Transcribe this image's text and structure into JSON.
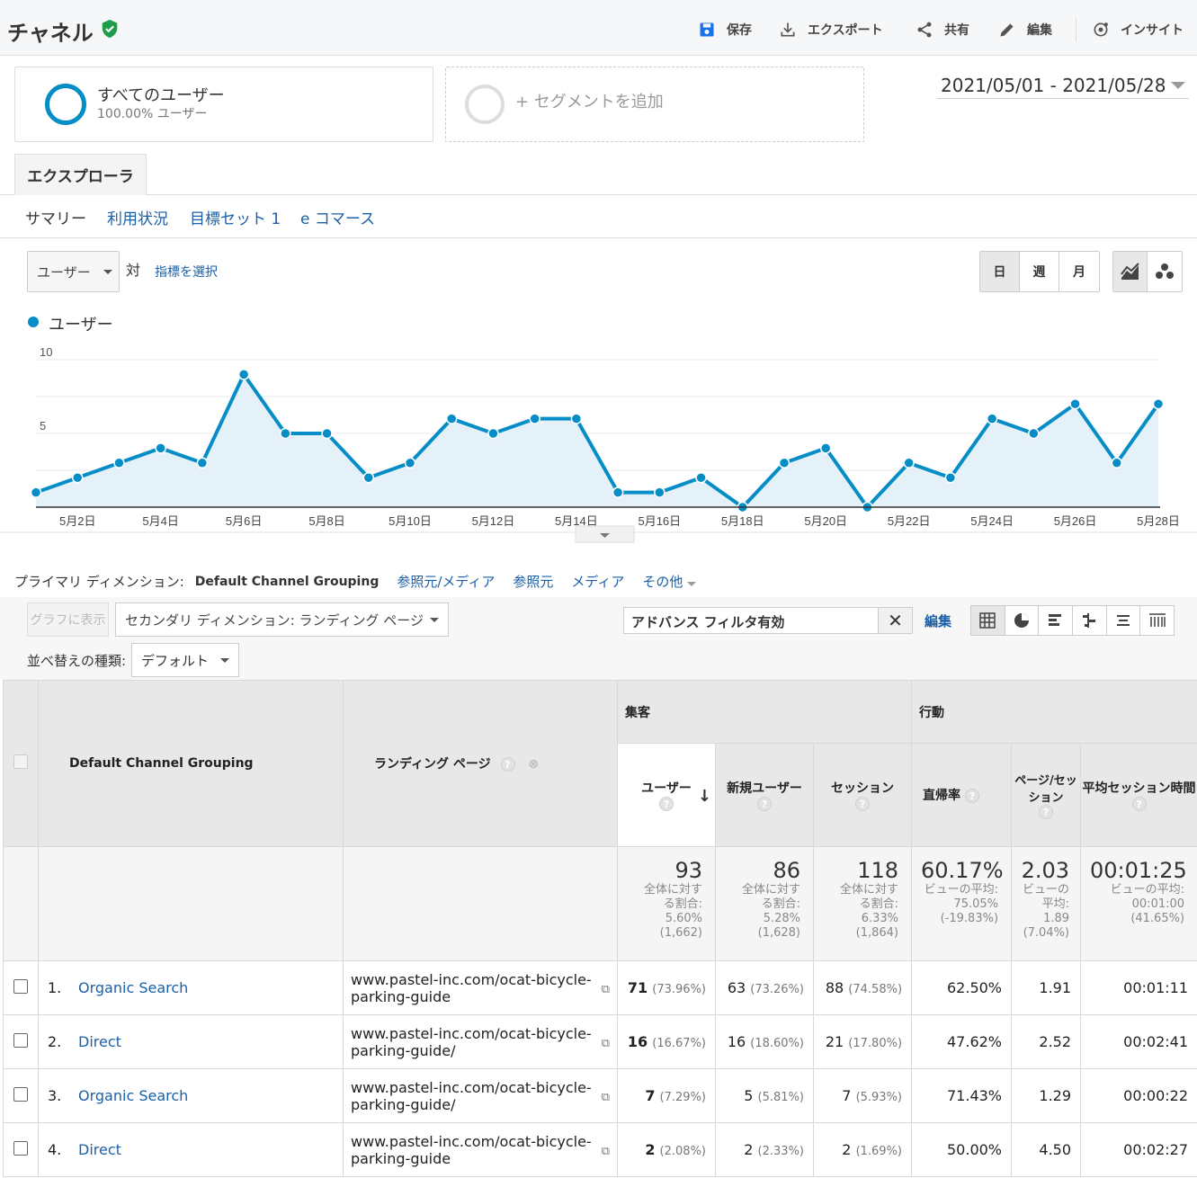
{
  "header": {
    "title": "チャネル",
    "toolbar": [
      {
        "icon": "save-icon",
        "label": "保存"
      },
      {
        "icon": "export-icon",
        "label": "エクスポート"
      },
      {
        "icon": "share-icon",
        "label": "共有"
      },
      {
        "icon": "edit-icon",
        "label": "編集"
      },
      {
        "icon": "insight-icon",
        "label": "インサイト"
      }
    ]
  },
  "segments": {
    "all_users": {
      "title": "すべてのユーザー",
      "sub": "100.00% ユーザー"
    },
    "add_label": "+ セグメントを追加"
  },
  "date_range": "2021/05/01 - 2021/05/28",
  "explorer_tab": "エクスプローラ",
  "subtabs": [
    "サマリー",
    "利用状況",
    "目標セット 1",
    "e コマース"
  ],
  "chart_controls": {
    "metric": "ユーザー",
    "vs": "対",
    "select_metric": "指標を選択",
    "periods": [
      "日",
      "週",
      "月"
    ],
    "active_period": "日"
  },
  "chart_data": {
    "type": "area",
    "series": [
      {
        "name": "ユーザー",
        "color": "#058dc7",
        "values": [
          1,
          2,
          3,
          4,
          3,
          9,
          5,
          5,
          2,
          3,
          6,
          5,
          6,
          6,
          1,
          1,
          2,
          0,
          3,
          4,
          0,
          3,
          2,
          6,
          5,
          7,
          3,
          7
        ]
      }
    ],
    "x": [
      "5月1日",
      "5月2日",
      "5月3日",
      "5月4日",
      "5月5日",
      "5月6日",
      "5月7日",
      "5月8日",
      "5月9日",
      "5月10日",
      "5月11日",
      "5月12日",
      "5月13日",
      "5月14日",
      "5月15日",
      "5月16日",
      "5月17日",
      "5月18日",
      "5月19日",
      "5月20日",
      "5月21日",
      "5月22日",
      "5月23日",
      "5月24日",
      "5月25日",
      "5月26日",
      "5月27日",
      "5月28日"
    ],
    "x_tick_labels": [
      "5月2日",
      "5月4日",
      "5月6日",
      "5月8日",
      "5月10日",
      "5月12日",
      "5月14日",
      "5月16日",
      "5月18日",
      "5月20日",
      "5月22日",
      "5月24日",
      "5月26日",
      "5月28日"
    ],
    "y_ticks": [
      "10",
      "5"
    ],
    "ylim": [
      0,
      10
    ],
    "grid": true,
    "legend": "top-left"
  },
  "primary_dimension": {
    "label": "プライマリ ディメンション:",
    "selected": "Default Channel Grouping",
    "options": [
      "参照元/メディア",
      "参照元",
      "メディア",
      "その他"
    ]
  },
  "table_toolbar": {
    "plot_rows": "グラフに表示",
    "secondary_dimension": "セカンダリ ディメンション: ランディング ページ",
    "filter": "アドバンス フィルタ有効",
    "edit": "編集",
    "sort_label": "並べ替えの種類:",
    "sort_value": "デフォルト"
  },
  "table": {
    "col_channel": "Default Channel Grouping",
    "col_landing": "ランディング ページ",
    "group_acq": "集客",
    "group_beh": "行動",
    "col_users": "ユーザー",
    "col_new_users": "新規ユーザー",
    "col_sessions": "セッション",
    "col_bounce": "直帰率",
    "col_pps": "ページ/セッション",
    "col_avg": "平均セッション時間",
    "totals": {
      "users": "93",
      "users_sub": "全体に対する割合: 5.60% (1,662)",
      "new_users": "86",
      "new_users_sub": "全体に対する割合: 5.28% (1,628)",
      "sessions": "118",
      "sessions_sub": "全体に対する割合: 6.33% (1,864)",
      "bounce": "60.17%",
      "bounce_sub": "ビューの平均: 75.05% (-19.83%)",
      "pps": "2.03",
      "pps_sub": "ビューの平均: 1.89 (7.04%)",
      "avg": "00:01:25",
      "avg_sub": "ビューの平均: 00:01:00 (41.65%)"
    },
    "rows": [
      {
        "idx": "1.",
        "channel": "Organic Search",
        "landing": "www.pastel-inc.com/ocat-bicycle-parking-guide",
        "users": "71",
        "users_pct": "(73.96%)",
        "new_users": "63",
        "new_users_pct": "(73.26%)",
        "sessions": "88",
        "sessions_pct": "(74.58%)",
        "bounce": "62.50%",
        "pps": "1.91",
        "avg": "00:01:11"
      },
      {
        "idx": "2.",
        "channel": "Direct",
        "landing": "www.pastel-inc.com/ocat-bicycle-parking-guide/",
        "users": "16",
        "users_pct": "(16.67%)",
        "new_users": "16",
        "new_users_pct": "(18.60%)",
        "sessions": "21",
        "sessions_pct": "(17.80%)",
        "bounce": "47.62%",
        "pps": "2.52",
        "avg": "00:02:41"
      },
      {
        "idx": "3.",
        "channel": "Organic Search",
        "landing": "www.pastel-inc.com/ocat-bicycle-parking-guide/",
        "users": "7",
        "users_pct": "(7.29%)",
        "new_users": "5",
        "new_users_pct": "(5.81%)",
        "sessions": "7",
        "sessions_pct": "(5.93%)",
        "bounce": "71.43%",
        "pps": "1.29",
        "avg": "00:00:22"
      },
      {
        "idx": "4.",
        "channel": "Direct",
        "landing": "www.pastel-inc.com/ocat-bicycle-parking-guide",
        "users": "2",
        "users_pct": "(2.08%)",
        "new_users": "2",
        "new_users_pct": "(2.33%)",
        "sessions": "2",
        "sessions_pct": "(1.69%)",
        "bounce": "50.00%",
        "pps": "4.50",
        "avg": "00:02:27"
      }
    ]
  }
}
